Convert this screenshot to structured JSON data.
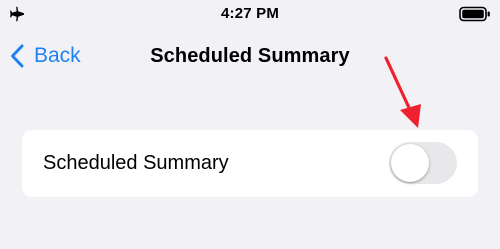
{
  "status_bar": {
    "time": "4:27 PM",
    "left_icon": "airplane-icon",
    "right_icon": "battery-icon"
  },
  "nav": {
    "back_label": "Back",
    "back_icon": "chevron-left-icon",
    "title": "Scheduled Summary"
  },
  "settings": {
    "row_label": "Scheduled Summary",
    "toggle_on": false
  },
  "colors": {
    "accent": "#1e82f6",
    "background": "#f2f2f6",
    "card": "#ffffff",
    "toggle_off": "#e8e8eb",
    "annotation_arrow": "#f0202d"
  }
}
